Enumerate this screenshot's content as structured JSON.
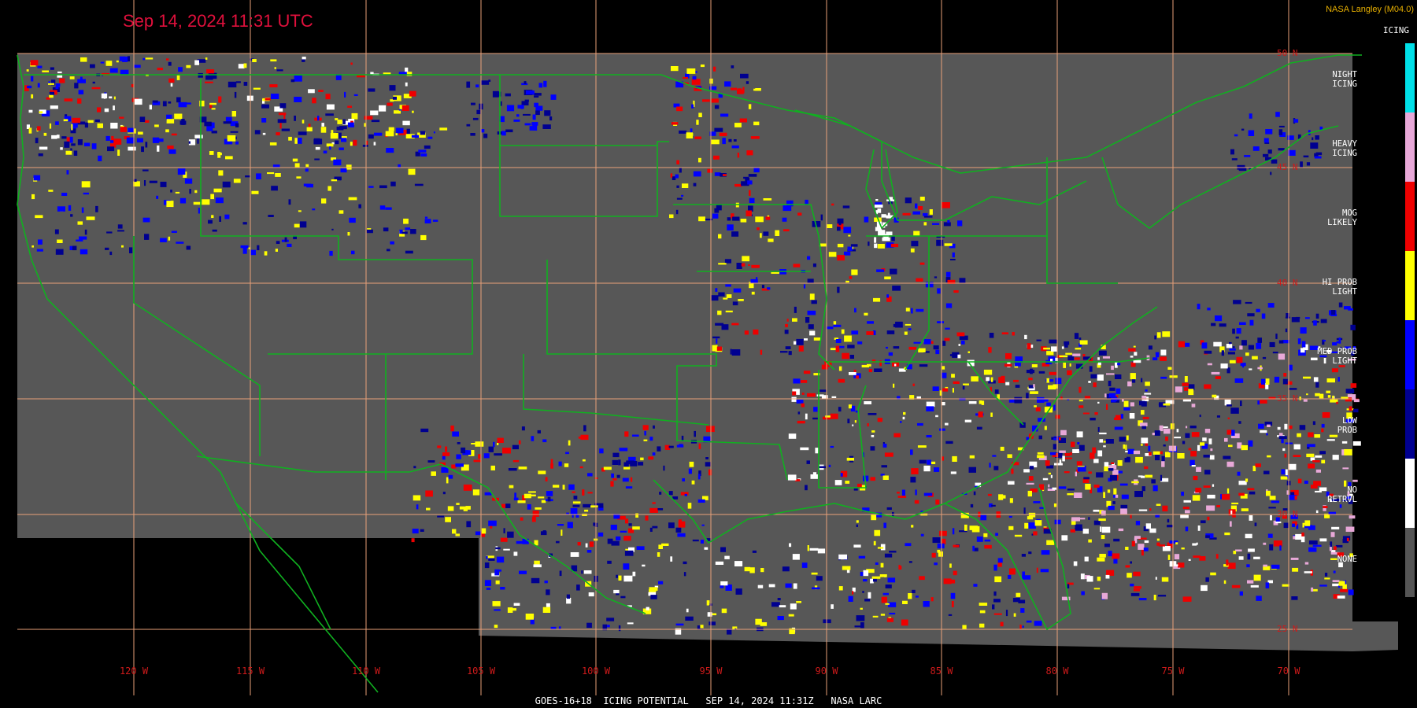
{
  "title": "Sep 14, 2024 11:31 UTC",
  "credit": "NASA Langley (M04.0)",
  "footer": "GOES-16+18  ICING POTENTIAL   SEP 14, 2024 11:31Z   NASA LARC",
  "longitudes": [
    "120 W",
    "115 W",
    "110 W",
    "105 W",
    "100 W",
    "95 W",
    "90 W",
    "85 W",
    "80 W",
    "75 W",
    "70 W"
  ],
  "latitudes": [
    "50 N",
    "45 N",
    "40 N",
    "35 N",
    "30 N",
    "25 N"
  ],
  "legend": {
    "title": "ICING",
    "items": [
      {
        "label": "NIGHT\nICING",
        "color": "#00e0e8"
      },
      {
        "label": "HEAVY\nICING",
        "color": "#e8a8d8"
      },
      {
        "label": "MOG\nLIKELY",
        "color": "#ee0000"
      },
      {
        "label": "HI PROB\nLIGHT",
        "color": "#ffff00"
      },
      {
        "label": "MED PROB\nLIGHT",
        "color": "#0000ff"
      },
      {
        "label": "LOW\nPROB",
        "color": "#000090"
      },
      {
        "label": "NO\nRETRVL",
        "color": "#ffffff"
      },
      {
        "label": "NONE",
        "color": "#555555"
      }
    ]
  }
}
